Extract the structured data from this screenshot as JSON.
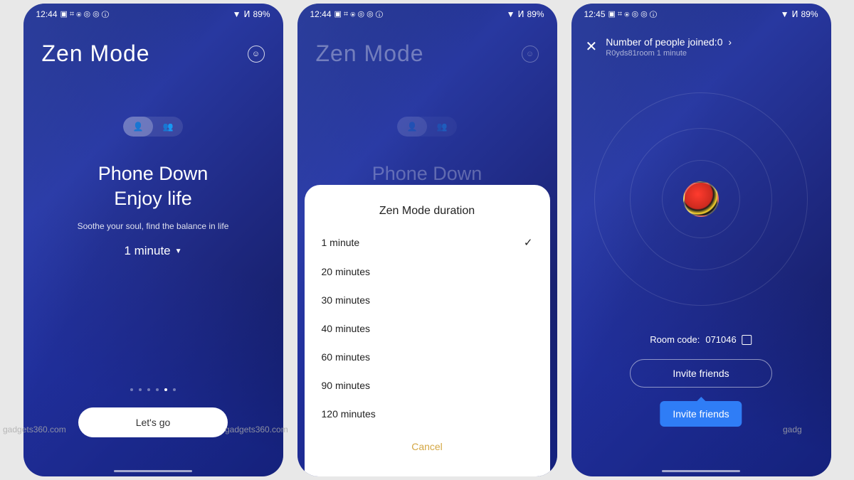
{
  "status": {
    "time1": "12:44",
    "time2": "12:44",
    "time3": "12:45",
    "battery": "89%",
    "icons": "▣ ⌗ ⦿ ◎ ◎ ⓘ"
  },
  "screen1": {
    "title": "Zen Mode",
    "headline_l1": "Phone Down",
    "headline_l2": "Enjoy life",
    "subtext": "Soothe your soul, find the balance in life",
    "duration": "1 minute",
    "button": "Let's go"
  },
  "screen2": {
    "title": "Zen Mode",
    "headline_peek": "Phone Down",
    "sheet_title": "Zen Mode duration",
    "options": [
      "1 minute",
      "20 minutes",
      "30 minutes",
      "40 minutes",
      "60 minutes",
      "90 minutes",
      "120 minutes"
    ],
    "selected_index": 0,
    "cancel": "Cancel"
  },
  "screen3": {
    "joined_label": "Number of people joined:",
    "joined_count": "0",
    "room_sub": "R0yds81room 1 minute",
    "room_code_label": "Room code:",
    "room_code_value": "071046",
    "invite": "Invite friends",
    "tooltip": "Invite friends"
  },
  "watermark": "gadgets360.com"
}
